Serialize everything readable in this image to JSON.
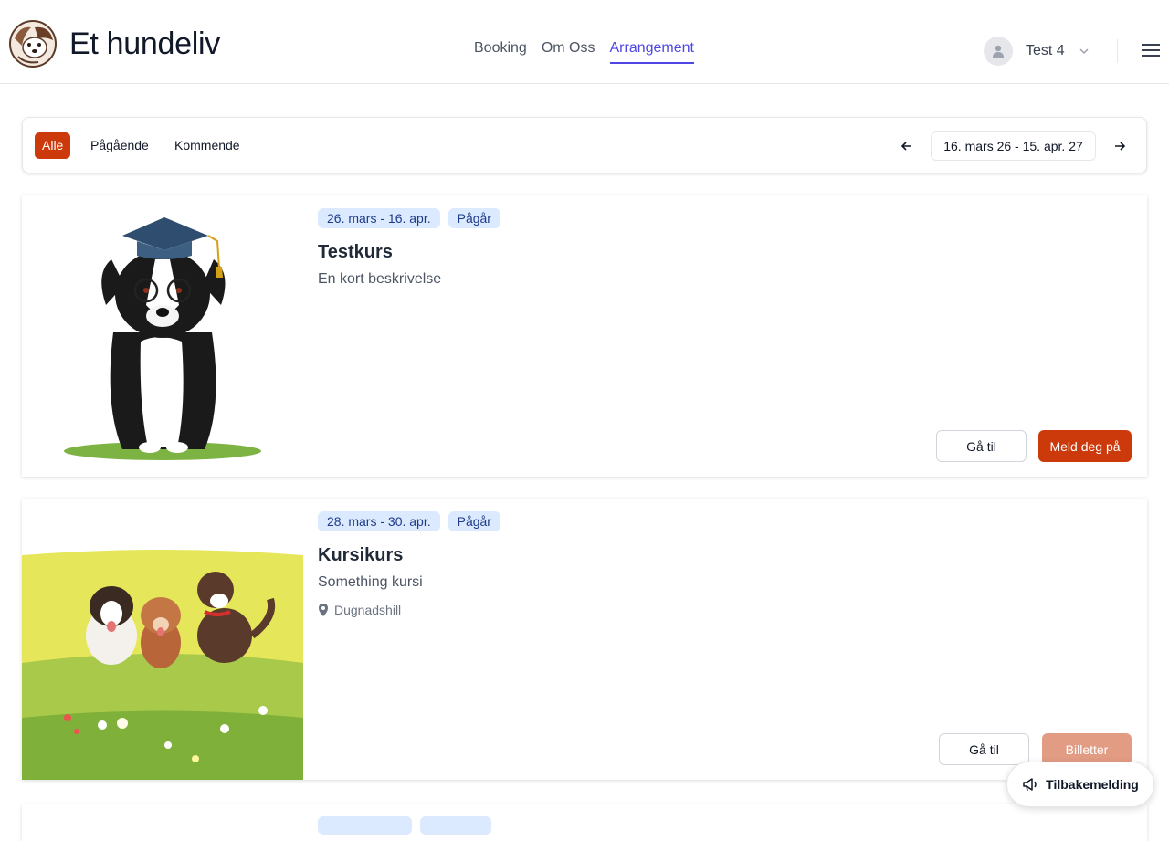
{
  "brand": {
    "name": "Et hundeliv",
    "logo_icon": "dog-logo-icon"
  },
  "nav": {
    "items": [
      {
        "label": "Booking",
        "active": false
      },
      {
        "label": "Om Oss",
        "active": false
      },
      {
        "label": "Arrangement",
        "active": true
      }
    ]
  },
  "user": {
    "name": "Test 4",
    "avatar_icon": "user-icon"
  },
  "filters": {
    "all": "Alle",
    "ongoing": "Pågående",
    "upcoming": "Kommende",
    "active": "Alle"
  },
  "date_range": {
    "label": "16. mars 26 - 15. apr. 27"
  },
  "events": [
    {
      "date_tag": "26. mars - 16. apr.",
      "status_tag": "Pågår",
      "title": "Testkurs",
      "description": "En kort beskrivelse",
      "location": null,
      "secondary_button": "Gå til",
      "primary_button": "Meld deg på",
      "primary_enabled": true
    },
    {
      "date_tag": "28. mars - 30. apr.",
      "status_tag": "Pågår",
      "title": "Kursikurs",
      "description": "Something kursi",
      "location": "Dugnadshill",
      "secondary_button": "Gå til",
      "primary_button": "Billetter",
      "primary_enabled": false
    }
  ],
  "feedback": {
    "label": "Tilbakemelding",
    "icon": "megaphone-icon"
  },
  "colors": {
    "accent": "#cc3a0c",
    "nav_active": "#4f46e5",
    "tag_bg": "#dbeafe",
    "tag_text": "#1e3a8a"
  }
}
